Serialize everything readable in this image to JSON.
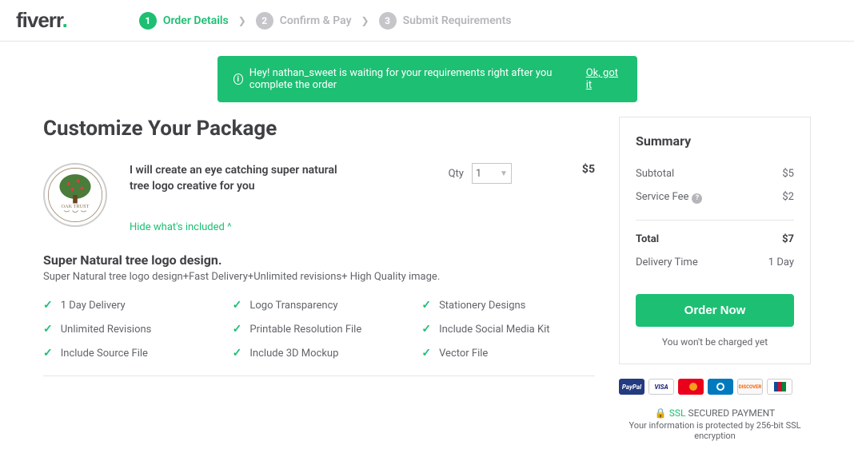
{
  "logo": "fiverr",
  "steps": [
    {
      "num": "1",
      "label": "Order Details",
      "active": true
    },
    {
      "num": "2",
      "label": "Confirm & Pay",
      "active": false
    },
    {
      "num": "3",
      "label": "Submit Requirements",
      "active": false
    }
  ],
  "notice": {
    "text": "Hey! nathan_sweet is waiting for your requirements right after you complete the order",
    "link": "Ok, got it"
  },
  "page_title": "Customize Your Package",
  "gig": {
    "title": "I will create an eye catching super natural tree logo creative for you",
    "hide_link": "Hide what's included ^",
    "qty_label": "Qty",
    "qty_value": "1",
    "price": "$5",
    "logo_text": "OAK TRUST"
  },
  "section": {
    "title": "Super Natural tree logo design.",
    "sub": "Super Natural tree logo design+Fast Delivery+Unlimited revisions+ High Quality image."
  },
  "features": [
    "1 Day Delivery",
    "Logo Transparency",
    "Stationery Designs",
    "Unlimited Revisions",
    "Printable Resolution File",
    "Include Social Media Kit",
    "Include Source File",
    "Include 3D Mockup",
    "Vector File"
  ],
  "summary": {
    "title": "Summary",
    "subtotal_label": "Subtotal",
    "subtotal_value": "$5",
    "fee_label": "Service Fee",
    "fee_value": "$2",
    "total_label": "Total",
    "total_value": "$7",
    "delivery_label": "Delivery Time",
    "delivery_value": "1 Day",
    "order_btn": "Order Now",
    "charge_note": "You won't be charged yet"
  },
  "ssl": {
    "line1_ssl": "SSL",
    "line1_rest": " SECURED PAYMENT",
    "line2": "Your information is protected by 256-bit SSL encryption"
  },
  "payment_labels": {
    "paypal": "PayPal",
    "visa": "VISA",
    "discover": "DISCOVER"
  }
}
